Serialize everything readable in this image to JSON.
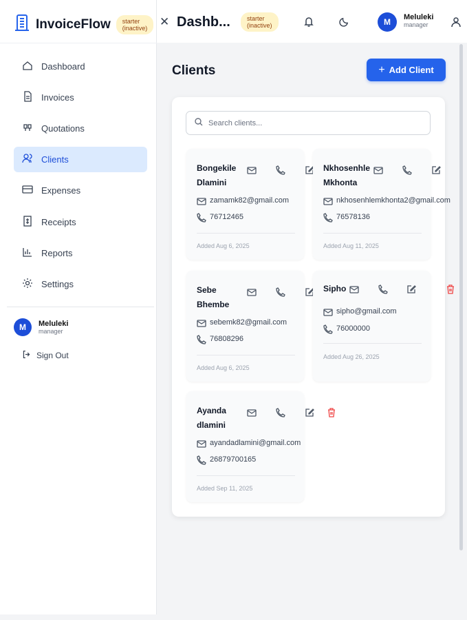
{
  "app": {
    "name": "InvoiceFlow",
    "plan_badge": "starter\n(inactive)"
  },
  "header": {
    "title": "Dashb...",
    "plan_badge": "starter\n(inactive)",
    "user_name": "Meluleki",
    "user_role": "manager",
    "avatar_initial": "M"
  },
  "sidebar": {
    "items": [
      {
        "label": "Dashboard",
        "icon": "home-icon"
      },
      {
        "label": "Invoices",
        "icon": "file-icon"
      },
      {
        "label": "Quotations",
        "icon": "quote-icon"
      },
      {
        "label": "Clients",
        "icon": "users-icon",
        "active": true
      },
      {
        "label": "Expenses",
        "icon": "credit-card-icon"
      },
      {
        "label": "Receipts",
        "icon": "receipt-icon"
      },
      {
        "label": "Reports",
        "icon": "bar-chart-icon"
      },
      {
        "label": "Settings",
        "icon": "gear-icon"
      }
    ],
    "user_name": "Meluleki",
    "user_role": "manager",
    "avatar_initial": "M",
    "sign_out": "Sign Out"
  },
  "page": {
    "title": "Clients",
    "add_button": "Add Client",
    "search_placeholder": "Search clients..."
  },
  "clients": [
    {
      "name": "Bongekile Dlamini",
      "email": "zamamk82@gmail.com",
      "phone": "76712465",
      "added": "Added Aug 6, 2025"
    },
    {
      "name": "Nkhosenhle Mkhonta",
      "email": "nkhosenhlemkhonta2@gmail.com",
      "phone": "76578136",
      "added": "Added Aug 11, 2025"
    },
    {
      "name": "Sebe Bhembe",
      "email": "sebemk82@gmail.com",
      "phone": "76808296",
      "added": "Added Aug 6, 2025"
    },
    {
      "name": "Sipho",
      "email": "sipho@gmail.com",
      "phone": "76000000",
      "added": "Added Aug 26, 2025"
    },
    {
      "name": "Ayanda dlamini",
      "email": "ayandadlamini@gmail.com",
      "phone": "26879700165",
      "added": "Added Sep 11, 2025"
    }
  ],
  "colors": {
    "accent": "#2563eb",
    "danger": "#ef4444",
    "badge": "#fef3c7"
  }
}
